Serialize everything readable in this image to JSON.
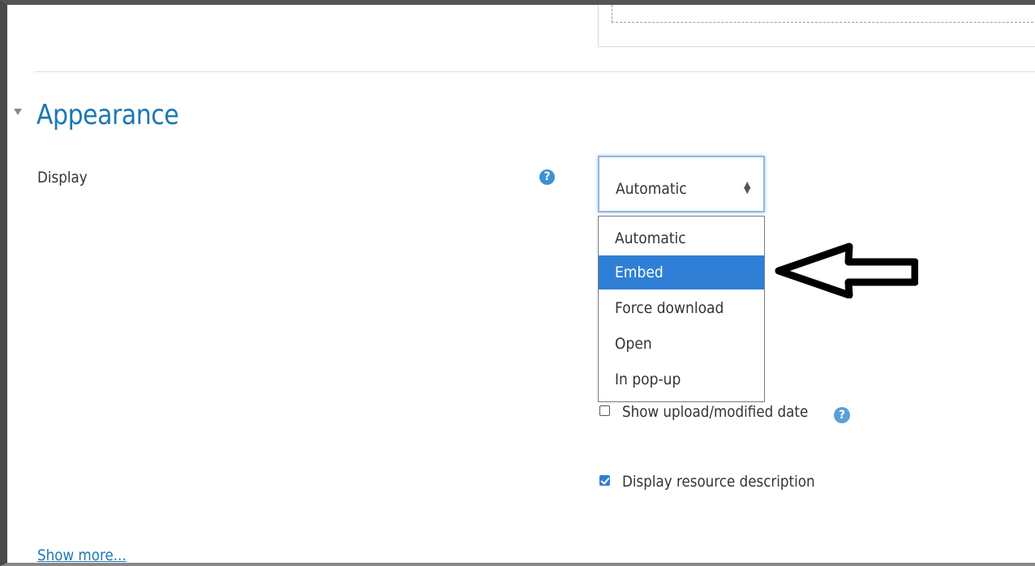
{
  "section": {
    "title": "Appearance"
  },
  "display_field": {
    "label": "Display",
    "help_glyph": "?",
    "selected_value": "Automatic",
    "options": [
      {
        "label": "Automatic",
        "highlighted": false
      },
      {
        "label": "Embed",
        "highlighted": true
      },
      {
        "label": "Force download",
        "highlighted": false
      },
      {
        "label": "Open",
        "highlighted": false
      },
      {
        "label": "In pop-up",
        "highlighted": false
      }
    ]
  },
  "checkboxes": [
    {
      "label": "Show upload/modified date",
      "checked": false,
      "help_glyph": "?"
    },
    {
      "label": "Display resource description",
      "checked": true
    }
  ],
  "footer": {
    "show_more": "Show more..."
  },
  "icons": {
    "section_toggle": "triangle-down-icon",
    "help": "question-circle-icon",
    "caret": "up-down-caret-icon",
    "annotation": "left-arrow-icon"
  },
  "colors": {
    "accent": "#1b77b6",
    "highlight": "#2f7fd6",
    "help_icon": "#3d8fd6",
    "text": "#333333"
  }
}
